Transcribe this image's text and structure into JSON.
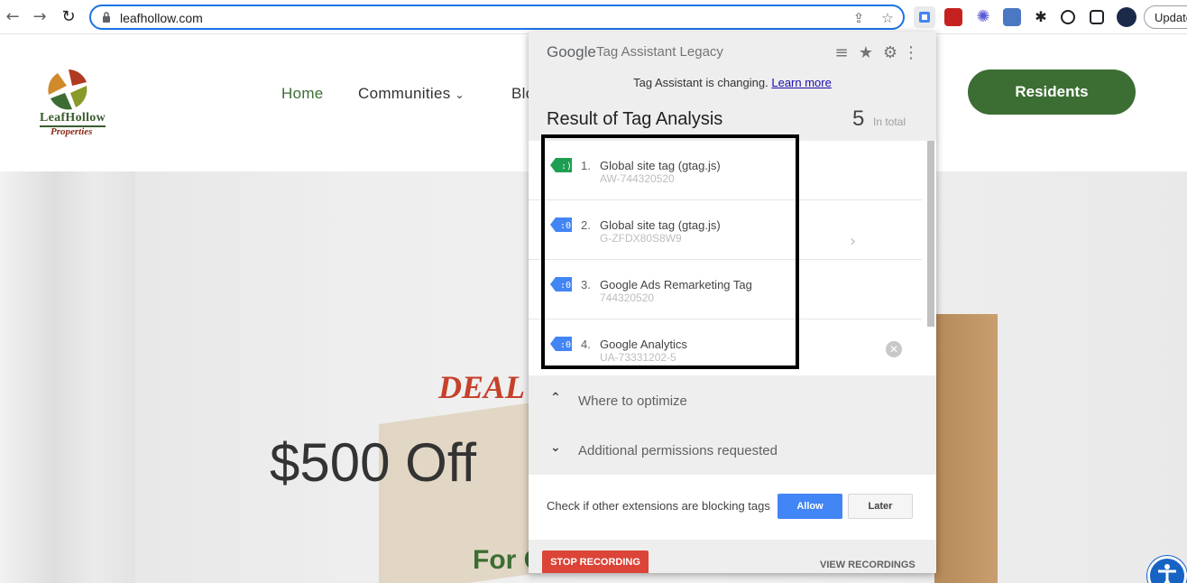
{
  "browser": {
    "url": "leafhollow.com",
    "update_label": "Update",
    "icons": [
      "back-icon",
      "forward-icon",
      "reload-icon",
      "lock-icon",
      "share-icon",
      "star-icon",
      "tag-assistant-extension-icon",
      "extension-icon",
      "puzzle-icon",
      "sidebar-icon",
      "profile-avatar"
    ]
  },
  "site": {
    "logo_line1": "LeafHollow",
    "logo_line2": "Properties",
    "nav": [
      "Home",
      "Communities",
      "Blo"
    ],
    "residents_label": "Residents",
    "hero_deal": "DEAL",
    "hero_price": "$500 Off",
    "hero_for": "For C",
    "brand_green": "#3c6e33"
  },
  "popup": {
    "brand": "Google",
    "product": "Tag Assistant Legacy",
    "notice_text": "Tag Assistant is changing.",
    "notice_link": "Learn more",
    "result_title": "Result of Tag Analysis",
    "total_count": "5",
    "total_label": "In total",
    "tags": [
      {
        "num": "1.",
        "name": "Global site tag (gtag.js)",
        "id": "AW-744320520",
        "color": "#1e9e52"
      },
      {
        "num": "2.",
        "name": "Global site tag (gtag.js)",
        "id": "G-ZFDX80S8W9",
        "color": "#4285f4"
      },
      {
        "num": "3.",
        "name": "Google Ads Remarketing Tag",
        "id": "744320520",
        "color": "#4285f4"
      },
      {
        "num": "4.",
        "name": "Google Analytics",
        "id": "UA-73331202-5",
        "color": "#4285f4"
      }
    ],
    "sections": [
      "Where to optimize",
      "Additional permissions requested"
    ],
    "perm_text": "Check if other extensions are blocking tags",
    "allow_label": "Allow",
    "later_label": "Later",
    "stop_label": "STOP RECORDING",
    "view_label": "VIEW RECORDINGS"
  }
}
